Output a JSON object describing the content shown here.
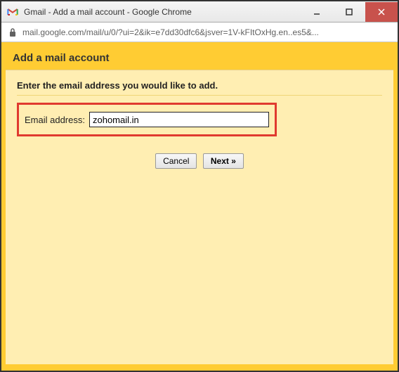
{
  "window": {
    "title": "Gmail - Add a mail account - Google Chrome",
    "url": "mail.google.com/mail/u/0/?ui=2&ik=e7dd30dfc6&jsver=1V-kFItOxHg.en..es5&..."
  },
  "page": {
    "heading": "Add a mail account",
    "instruction": "Enter the email address you would like to add.",
    "email_label": "Email address:",
    "email_value": "zohomail.in",
    "buttons": {
      "cancel": "Cancel",
      "next": "Next »"
    }
  }
}
